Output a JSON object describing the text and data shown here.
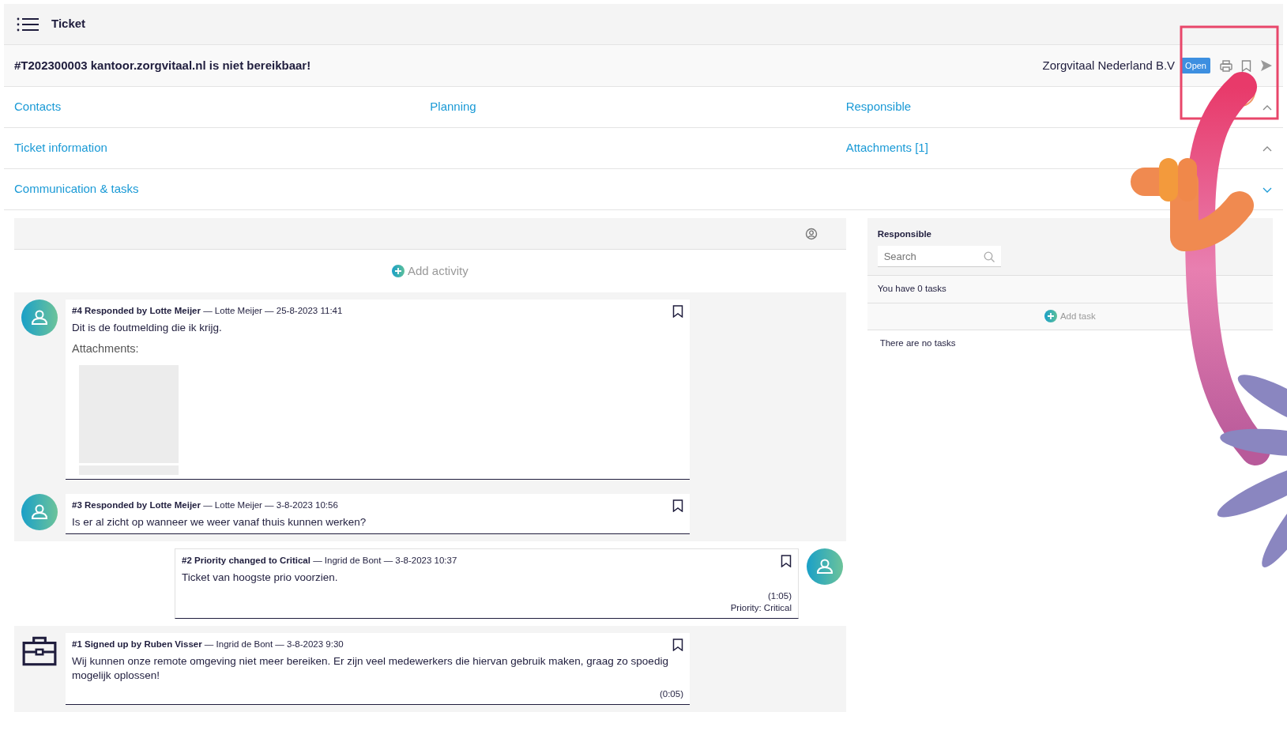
{
  "topbar": {
    "title": "Ticket"
  },
  "ticket": {
    "title": "#T202300003 kantoor.zorgvitaal.nl is niet bereikbaar!",
    "company": "Zorgvitaal Nederland B.V",
    "status": "Open"
  },
  "sections": [
    {
      "left": "Contacts",
      "middle": "Planning",
      "right": "Responsible",
      "expanded": false
    },
    {
      "left": "Ticket information",
      "right": "Attachments [1]",
      "expanded": false
    },
    {
      "left": "Communication & tasks",
      "expanded": true
    }
  ],
  "add_activity": "Add activity",
  "activities": [
    {
      "kind": "response",
      "heading": "**#4 Responded by Lotte Meijer** — Lotte Meijer — 25-8-2023 11:41",
      "body": "Dit is de foutmelding die ik krijg.",
      "attachments_label": "Attachments:"
    },
    {
      "kind": "response",
      "heading": "**#3 Responded by Lotte Meijer** — Lotte Meijer — 3-8-2023 10:56",
      "body": "Is er al zicht op wanneer we weer vanaf thuis kunnen werken?"
    },
    {
      "kind": "change",
      "heading": "**#2 Priority changed to Critical** — Ingrid de Bont — 3-8-2023 10:37",
      "body": "Ticket van hoogste prio voorzien.",
      "duration": "(1:05)",
      "note": "Priority: Critical"
    },
    {
      "kind": "signup",
      "heading": "**#1 Signed up by Ruben Visser** — Ingrid de Bont — 3-8-2023 9:30",
      "body": "Wij kunnen onze remote omgeving niet meer bereiken. Er zijn veel medewerkers die hiervan gebruik maken, graag zo spoedig mogelijk oplossen!",
      "duration": "(0:05)"
    }
  ],
  "tasks": {
    "label": "Responsible",
    "search": {
      "placeholder": "Search"
    },
    "count_text": "You have 0 tasks",
    "add_task": "Add task",
    "empty_text": "There are no tasks"
  }
}
